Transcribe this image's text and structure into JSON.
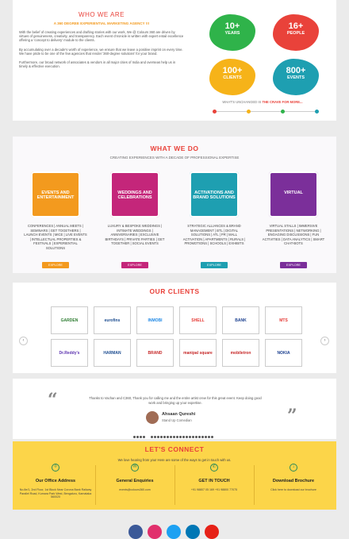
{
  "who": {
    "title": "WHO WE ARE",
    "subtitle": "A 360 DEGREE EXPERIENTIAL MARKETING AGENCY !!!",
    "p1": "With the belief of creating experiences and drafting stories with our work, We @ Colours 360 are driven by virtues of genuineness, creativity, and transparency. Each event chronicle is written with expert entail excellence offering a 'concept to delivery' module to the clients.",
    "p2": "By accumulating over a decade's worth of experience, we ensure that we leave a positive imprint on every time. We have pride to be one of the few agencies that render '360-degree solutions' for your brand.",
    "p3": "Furthermore, our broad network of associates & vendors in all major cities of India and overseas help us in timely & effective execution.",
    "stats": [
      {
        "num": "10+",
        "label": "YEARS",
        "color": "#2fb34a"
      },
      {
        "num": "16+",
        "label": "PEOPLE",
        "color": "#e9423a"
      },
      {
        "num": "100+",
        "label": "CLIENTS",
        "color": "#f6b319"
      },
      {
        "num": "800+",
        "label": "EVENTS",
        "color": "#1e9fb1"
      }
    ],
    "tagline_prefix": "WHAT'S UNCHANGED IS ",
    "tagline_bold": "THE CRAVE FOR MORE...",
    "dot_colors": [
      "#e9423a",
      "#f6b319",
      "#2fb34a",
      "#1e9fb1",
      "#2a8a5a"
    ]
  },
  "what": {
    "title": "WHAT WE DO",
    "subtitle": "CREATING EXPERIENCES WITH A DECADE OF PROFESSIONAL EXPERTISE",
    "services": [
      {
        "name": "EVENTS AND ENTERTAINMENT",
        "color": "#f39a1e",
        "text": "CONFERENCES | ANNUAL MEETS | SEMINARS | GET TOGETHERS | LAUNCH EVENTS | MICE | LIVE EVENTS | INTELLECTUAL PROPERTIES & FESTIVALS | EXPERIENTIAL SOLUTIONS",
        "button": "EXPLORE"
      },
      {
        "name": "WEDDINGS AND CELEBRATIONS",
        "color": "#c4267a",
        "text": "LUXURY & BESPOKE WEDDINGS | INTIMATE WEDDINGS | ANNIVERSARIES | EXCLUSIVE BIRTHDAYS | PRIVATE PARTIES | GET TOGETHER | SOCIAL EVENTS",
        "button": "EXPLORE"
      },
      {
        "name": "ACTIVATIONS AND BRAND SOLUTIONS",
        "color": "#1e9fb1",
        "text": "STRATEGIC ALLIANCES & BRAND MANAGEMENT | BTL | DIGITAL SOLUTIONS | ATL | PR | MALL ACTIVATION | APARTMENTS | RURALS | PROMOTIONS | SCHOOLS | EXHIBITS",
        "button": "EXPLORE"
      },
      {
        "name": "VIRTUAL",
        "color": "#7b2f9a",
        "text": "VIRTUAL STALLS | IMMERSIVE PRESENTATIONS | NETWORKING | ENGAGING DISCUSSIONS | FUN ACTIVITIES | DATA ANALYTICS | SMART CHAT-BOTS",
        "button": "EXPLORE"
      }
    ]
  },
  "clients": {
    "title": "OUR CLIENTS",
    "logos_row1": [
      {
        "name": "GARDEN",
        "color": "#2e7d32"
      },
      {
        "name": "eurofins",
        "color": "#1a4b8f"
      },
      {
        "name": "INMOBI",
        "color": "#1e88e5"
      },
      {
        "name": "SHELL",
        "color": "#e53935"
      },
      {
        "name": "BANK",
        "color": "#1a3f8f"
      },
      {
        "name": "MTS",
        "color": "#e53935"
      }
    ],
    "logos_row2": [
      {
        "name": "Dr.Reddy's",
        "color": "#5e35b1"
      },
      {
        "name": "HARMAN",
        "color": "#1a4b8f"
      },
      {
        "name": "BRAND",
        "color": "#c62828"
      },
      {
        "name": "manipal square",
        "color": "#c62828"
      },
      {
        "name": "mobiletron",
        "color": "#c62828"
      },
      {
        "name": "NOKIA",
        "color": "#1a3f8f"
      }
    ],
    "prev": "‹",
    "next": "›"
  },
  "testimonial": {
    "text": "Thanks to Vachan and C360, Thank you for calling me and the entire artist crew for this great event. Keep doing good work and bringing up your expertise.",
    "name": "Ahsaan Qureshi",
    "role": "Stand Up Comedian",
    "open_quote": "“",
    "close_quote": "”"
  },
  "connect": {
    "title": "LET'S CONNECT",
    "subtitle": "We love hearing from you! Here are some of the ways to get in touch with us.",
    "cards": [
      {
        "icon": "map-pin-icon",
        "glyph": "⌾",
        "head": "Our Office Address",
        "text": "No.8e/1, 2nd Floor, 1st Block Near Corona Bank Railway Parallel Road, Kumara Park West, Bengaluru, Karnataka 560020"
      },
      {
        "icon": "email-icon",
        "glyph": "✉",
        "head": "General Enquiries",
        "text": "events@colours360.com"
      },
      {
        "icon": "phone-icon",
        "glyph": "✆",
        "head": "GET IN TOUCH",
        "text": "+91 98807 05 169 +91 98800 77075"
      },
      {
        "icon": "download-icon",
        "glyph": "↓",
        "head": "Download Brochure",
        "text": "Click here to download our brochure"
      }
    ]
  },
  "social": [
    {
      "icon": "facebook-icon",
      "color": "#3b5998"
    },
    {
      "icon": "instagram-icon",
      "color": "#e1306c"
    },
    {
      "icon": "twitter-icon",
      "color": "#1da1f2"
    },
    {
      "icon": "linkedin-icon",
      "color": "#0077b5"
    },
    {
      "icon": "youtube-icon",
      "color": "#e62117"
    }
  ]
}
